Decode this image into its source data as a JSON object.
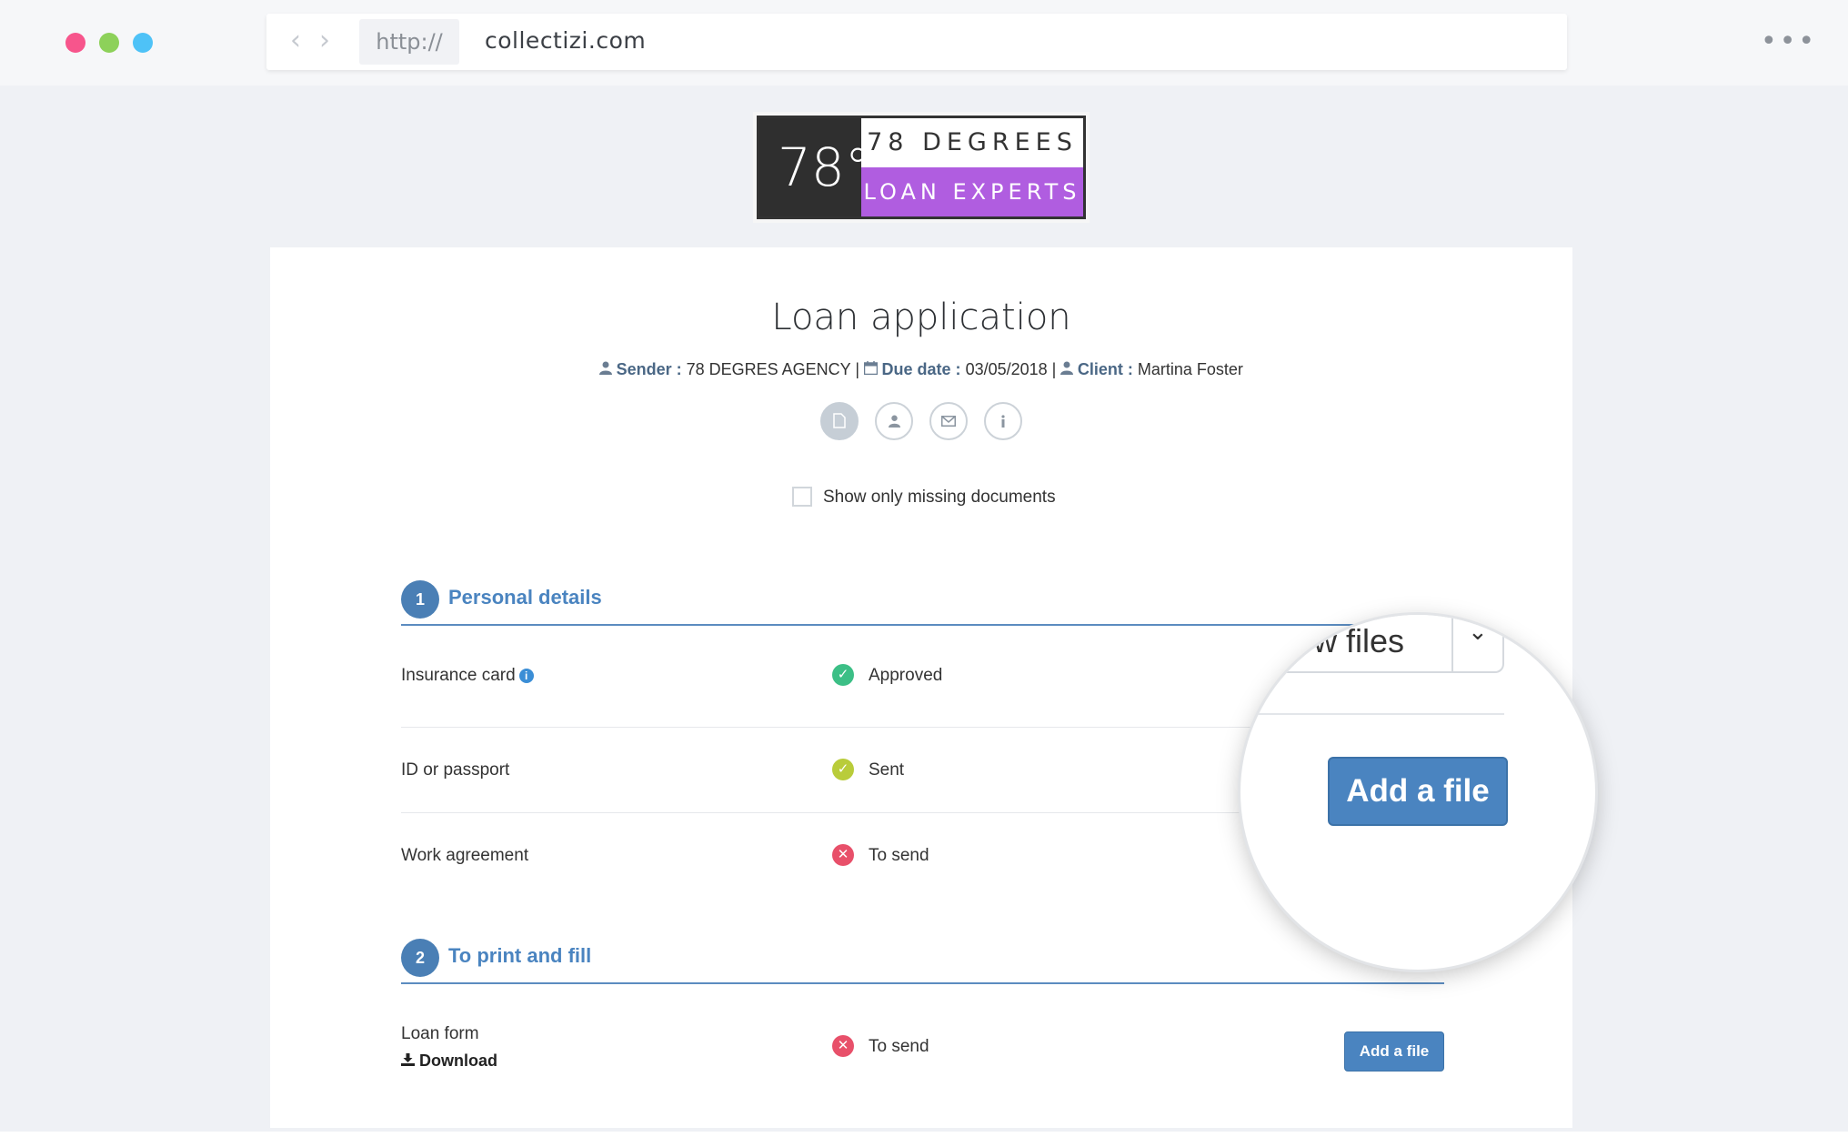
{
  "browser": {
    "protocol": "http://",
    "domain": "collectizi.com",
    "back_icon": "‹",
    "forward_icon": "›",
    "menu_icon": "•••"
  },
  "logo": {
    "big": "78°",
    "top": "78 DEGREES",
    "bottom": "LOAN EXPERTS"
  },
  "header": {
    "title": "Loan application",
    "sender_label": "Sender :",
    "sender_value": "78 DEGRES AGENCY",
    "due_label": "Due date :",
    "due_value": "03/05/2018",
    "client_label": "Client :",
    "client_value": "Martina Foster",
    "separator": "|"
  },
  "icons": [
    "document-icon",
    "user-icon",
    "envelope-icon",
    "info-icon"
  ],
  "filter": {
    "label": "Show only missing documents",
    "checked": false
  },
  "sections": [
    {
      "number": "1",
      "title": "Personal details",
      "rows": [
        {
          "name": "Insurance card",
          "status": "Approved",
          "status_icon": "check-circle-icon"
        },
        {
          "name": "ID or passport",
          "status": "Sent",
          "status_icon": "check-circle-icon"
        },
        {
          "name": "Work agreement",
          "status": "To send",
          "status_icon": "x-circle-icon"
        }
      ]
    },
    {
      "number": "2",
      "title": "To print and fill",
      "rows": [
        {
          "name": "Loan form",
          "download": "Download",
          "status": "To send",
          "status_icon": "x-circle-icon",
          "button": "Add a file"
        }
      ]
    }
  ],
  "magnifier": {
    "dropdown_text": "ɔw files",
    "button": "Add a file"
  },
  "colors": {
    "accent": "#4a84c0",
    "approved": "#3cbf86",
    "sent": "#b9cc3a",
    "to_send": "#e8506a",
    "logo_purple": "#b05de0"
  }
}
